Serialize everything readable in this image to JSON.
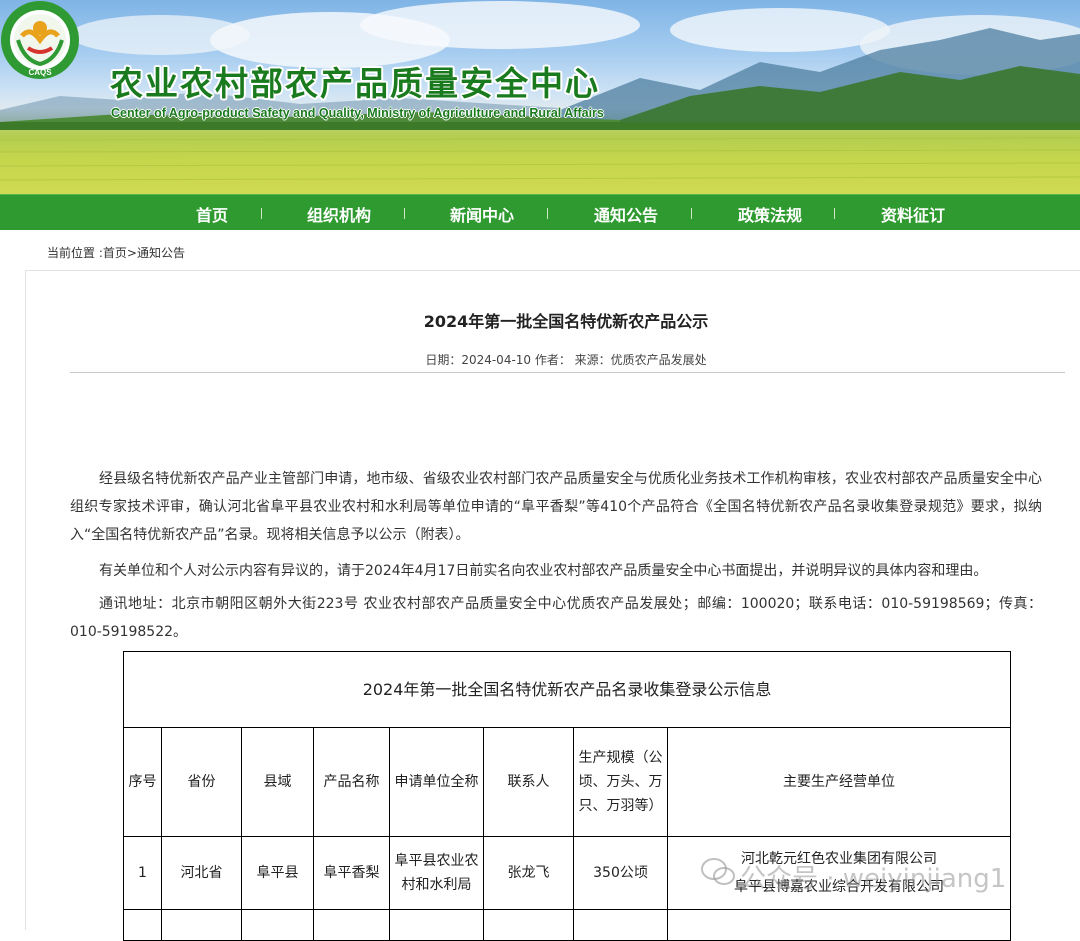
{
  "header": {
    "title": "农业农村部农产品质量安全中心",
    "subtitle": "Center of Agro-product Safety and Quality, Ministry of Agriculture and Rural Affairs",
    "logo_text": "CAQS"
  },
  "nav": {
    "items": [
      {
        "label": "首页"
      },
      {
        "label": "组织机构"
      },
      {
        "label": "新闻中心"
      },
      {
        "label": "通知公告"
      },
      {
        "label": "政策法规"
      },
      {
        "label": "资料征订"
      }
    ]
  },
  "breadcrumb": {
    "prefix": "当前位置 :",
    "home": "首页",
    "sep": ">",
    "current": "通知公告"
  },
  "article": {
    "title": "2024年第一批全国名特优新农产品公示",
    "meta": "日期：2024-04-10 作者： 来源：优质农产品发展处",
    "paragraphs": [
      "经县级名特优新农产品产业主管部门申请，地市级、省级农业农村部门农产品质量安全与优质化业务技术工作机构审核，农业农村部农产品质量安全中心组织专家技术评审，确认河北省阜平县农业农村和水利局等单位申请的“阜平香梨”等410个产品符合《全国名特优新农产品名录收集登录规范》要求，拟纳入“全国名特优新农产品”名录。现将相关信息予以公示（附表）。",
      "有关单位和个人对公示内容有异议的，请于2024年4月17日前实名向农业农村部农产品质量安全中心书面提出，并说明异议的具体内容和理由。",
      "通讯地址：北京市朝阳区朝外大街223号 农业农村部农产品质量安全中心优质农产品发展处；邮编：100020；联系电话：010-59198569；传真：010-59198522。"
    ]
  },
  "table": {
    "caption": "2024年第一批全国名特优新农产品名录收集登录公示信息",
    "headers": [
      "序号",
      "省份",
      "县域",
      "产品名称",
      "申请单位全称",
      "联系人",
      "生产规模（公顷、万头、万只、万羽等）",
      "主要生产经营单位"
    ],
    "rows": [
      [
        "1",
        "河北省",
        "阜平县",
        "阜平香梨",
        "阜平县农业农村和水利局",
        "张龙飞",
        "350公顷",
        "河北乾元红色农业集团有限公司\n阜平县博嘉农业综合开发有限公司"
      ]
    ]
  },
  "watermark": {
    "text": "公众号 · weiyinjiang1"
  }
}
